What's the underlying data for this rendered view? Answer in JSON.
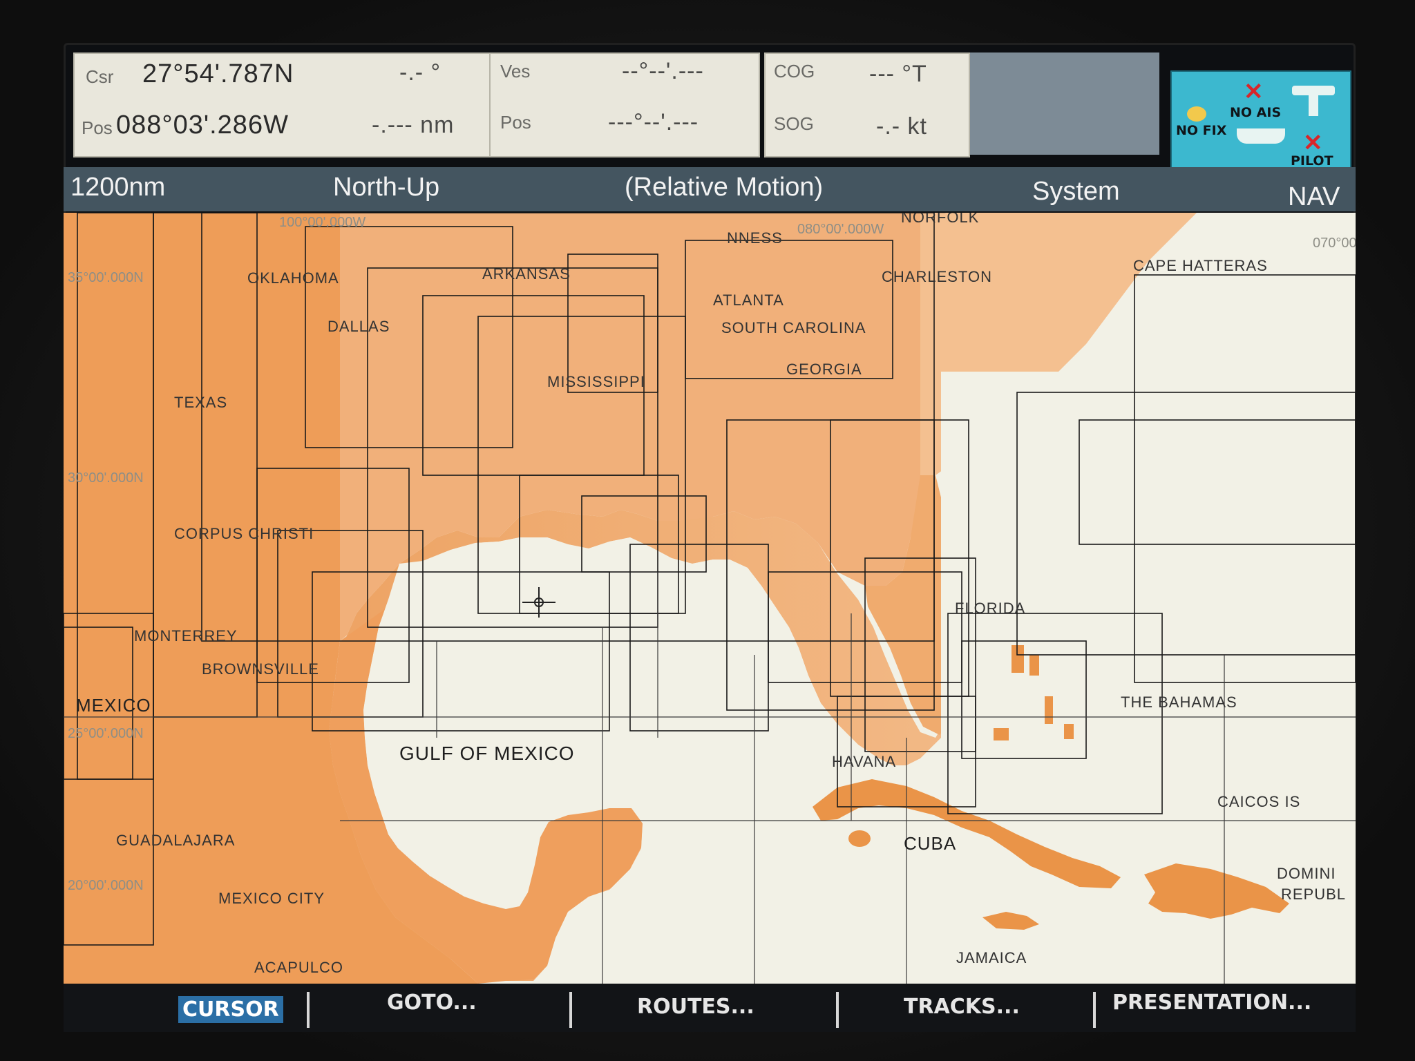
{
  "panels": {
    "csr": {
      "label": "Csr",
      "lat": "27°54'.787N",
      "bearing": "-.- °"
    },
    "pos": {
      "label": "Pos",
      "lon": "088°03'.286W",
      "range": "-.--- nm"
    },
    "ves": {
      "label": "Ves",
      "value": "--°--'.---"
    },
    "ves_pos": {
      "label": "Pos",
      "value": "---°--'.---"
    },
    "cog": {
      "label": "COG",
      "value": "--- °T"
    },
    "sog": {
      "label": "SOG",
      "value": "-.- kt"
    }
  },
  "status": {
    "nofix": "NO FIX",
    "noais": "NO AIS",
    "pilot": "PILOT"
  },
  "header": {
    "range": "1200nm",
    "orientation": "North-Up",
    "motion": "(Relative Motion)",
    "system": "System",
    "mode": "NAV"
  },
  "coords": {
    "lon100": "100°00'.000W",
    "lon80": "080°00'.000W",
    "lon70": "070°00",
    "lat35": "35°00'.000N",
    "lat30": "30°00'.000N",
    "lat25": "25°00'.000N",
    "lat20": "20°00'.000N"
  },
  "places": {
    "norfolk": "NORFOLK",
    "cape_hatteras": "CAPE HATTERAS",
    "oklahoma": "OKLAHOMA",
    "arkansas": "ARKANSAS",
    "charleston": "CHARLESTON",
    "atlanta": "ATLANTA",
    "dallas": "DALLAS",
    "south_carolina": "SOUTH CAROLINA",
    "georgia": "GEORGIA",
    "mississippi": "MISSISSIPPI",
    "texas": "TEXAS",
    "corpus_christi": "CORPUS CHRISTI",
    "florida": "FLORIDA",
    "monterrey": "MONTERREY",
    "brownsville": "BROWNSVILLE",
    "mexico": "MEXICO",
    "the_bahamas": "THE BAHAMAS",
    "gulf_of_mexico": "GULF OF MEXICO",
    "havana": "HAVANA",
    "caicos": "CAICOS IS",
    "cuba": "CUBA",
    "guadalajara": "GUADALAJARA",
    "dominican1": "DOMINI",
    "dominican2": "REPUBL",
    "mexico_city": "MEXICO CITY",
    "acapulco": "ACAPULCO",
    "jamaica": "JAMAICA",
    "tennessee_partial": "NNESS"
  },
  "softkeys": {
    "cursor": "CURSOR",
    "goto": "GOTO...",
    "routes": "ROUTES...",
    "tracks": "TRACKS...",
    "presentation": "PRESENTATION..."
  },
  "colors": {
    "land": "#f0a463",
    "water": "#f2f1e6",
    "header": "#445560",
    "status": "#3cb8cf"
  }
}
